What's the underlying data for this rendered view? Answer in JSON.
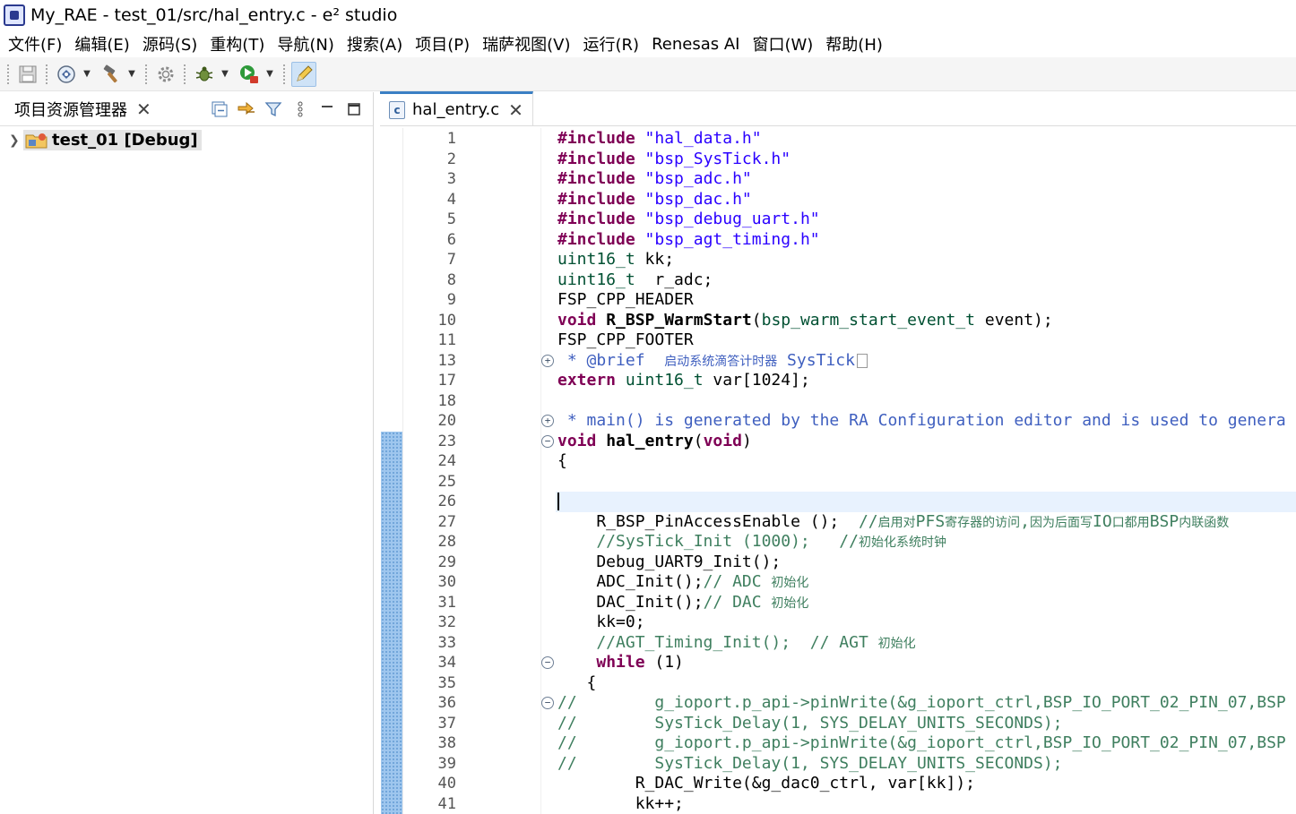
{
  "window": {
    "title": "My_RAE - test_01/src/hal_entry.c - e² studio"
  },
  "menu": [
    {
      "label": "文件(F)"
    },
    {
      "label": "编辑(E)"
    },
    {
      "label": "源码(S)"
    },
    {
      "label": "重构(T)"
    },
    {
      "label": "导航(N)"
    },
    {
      "label": "搜索(A)"
    },
    {
      "label": "项目(P)"
    },
    {
      "label": "瑞萨视图(V)"
    },
    {
      "label": "运行(R)"
    },
    {
      "label": "Renesas AI"
    },
    {
      "label": "窗口(W)"
    },
    {
      "label": "帮助(H)"
    }
  ],
  "toolbar": {
    "icons": [
      "save-icon",
      "debug-settings-icon",
      "build-hammer-icon",
      "settings-gear-icon",
      "debug-bug-icon",
      "run-icon",
      "edit-pencil-icon"
    ]
  },
  "explorer": {
    "tab_label": "项目资源管理器",
    "project_label": "test_01 [Debug]"
  },
  "editor": {
    "tab_label": "hal_entry.c",
    "current_line": 26,
    "changed_lines_from": 23,
    "lines": [
      {
        "num": "1",
        "code": "#include \"hal_data.h\""
      },
      {
        "num": "2",
        "code": "#include \"bsp_SysTick.h\""
      },
      {
        "num": "3",
        "code": "#include \"bsp_adc.h\""
      },
      {
        "num": "4",
        "code": "#include \"bsp_dac.h\""
      },
      {
        "num": "5",
        "code": "#include \"bsp_debug_uart.h\""
      },
      {
        "num": "6",
        "code": "#include \"bsp_agt_timing.h\""
      },
      {
        "num": "7",
        "code": "uint16_t kk;"
      },
      {
        "num": "8",
        "code": "uint16_t  r_adc;"
      },
      {
        "num": "9",
        "code": "FSP_CPP_HEADER"
      },
      {
        "num": "10",
        "code": "void R_BSP_WarmStart(bsp_warm_start_event_t event);"
      },
      {
        "num": "11",
        "code": "FSP_CPP_FOOTER"
      },
      {
        "num": "13",
        "code": " * @brief  启动系统滴答计时器 SysTick"
      },
      {
        "num": "17",
        "code": "extern uint16_t var[1024];"
      },
      {
        "num": "18",
        "code": ""
      },
      {
        "num": "20",
        "code": " * main() is generated by the RA Configuration editor and is used to genera"
      },
      {
        "num": "23",
        "code": "void hal_entry(void)"
      },
      {
        "num": "24",
        "code": "{"
      },
      {
        "num": "25",
        "code": ""
      },
      {
        "num": "26",
        "code": ""
      },
      {
        "num": "27",
        "code": "    R_BSP_PinAccessEnable ();  //启用对PFS寄存器的访问,因为后面写IO口都用BSP内联函数"
      },
      {
        "num": "28",
        "code": "    //SysTick_Init (1000);   //初始化系统时钟"
      },
      {
        "num": "29",
        "code": "    Debug_UART9_Init();"
      },
      {
        "num": "30",
        "code": "    ADC_Init();// ADC 初始化"
      },
      {
        "num": "31",
        "code": "    DAC_Init();// DAC 初始化"
      },
      {
        "num": "32",
        "code": "    kk=0;"
      },
      {
        "num": "33",
        "code": "    //AGT_Timing_Init();  // AGT 初始化"
      },
      {
        "num": "34",
        "code": "    while (1)"
      },
      {
        "num": "35",
        "code": "   {"
      },
      {
        "num": "36",
        "code": "//        g_ioport.p_api->pinWrite(&g_ioport_ctrl,BSP_IO_PORT_02_PIN_07,BSP"
      },
      {
        "num": "37",
        "code": "//        SysTick_Delay(1, SYS_DELAY_UNITS_SECONDS);"
      },
      {
        "num": "38",
        "code": "//        g_ioport.p_api->pinWrite(&g_ioport_ctrl,BSP_IO_PORT_02_PIN_07,BSP"
      },
      {
        "num": "39",
        "code": "//        SysTick_Delay(1, SYS_DELAY_UNITS_SECONDS);"
      },
      {
        "num": "40",
        "code": "        R_DAC_Write(&g_dac0_ctrl, var[kk]);"
      },
      {
        "num": "41",
        "code": "        kk++;"
      }
    ]
  }
}
